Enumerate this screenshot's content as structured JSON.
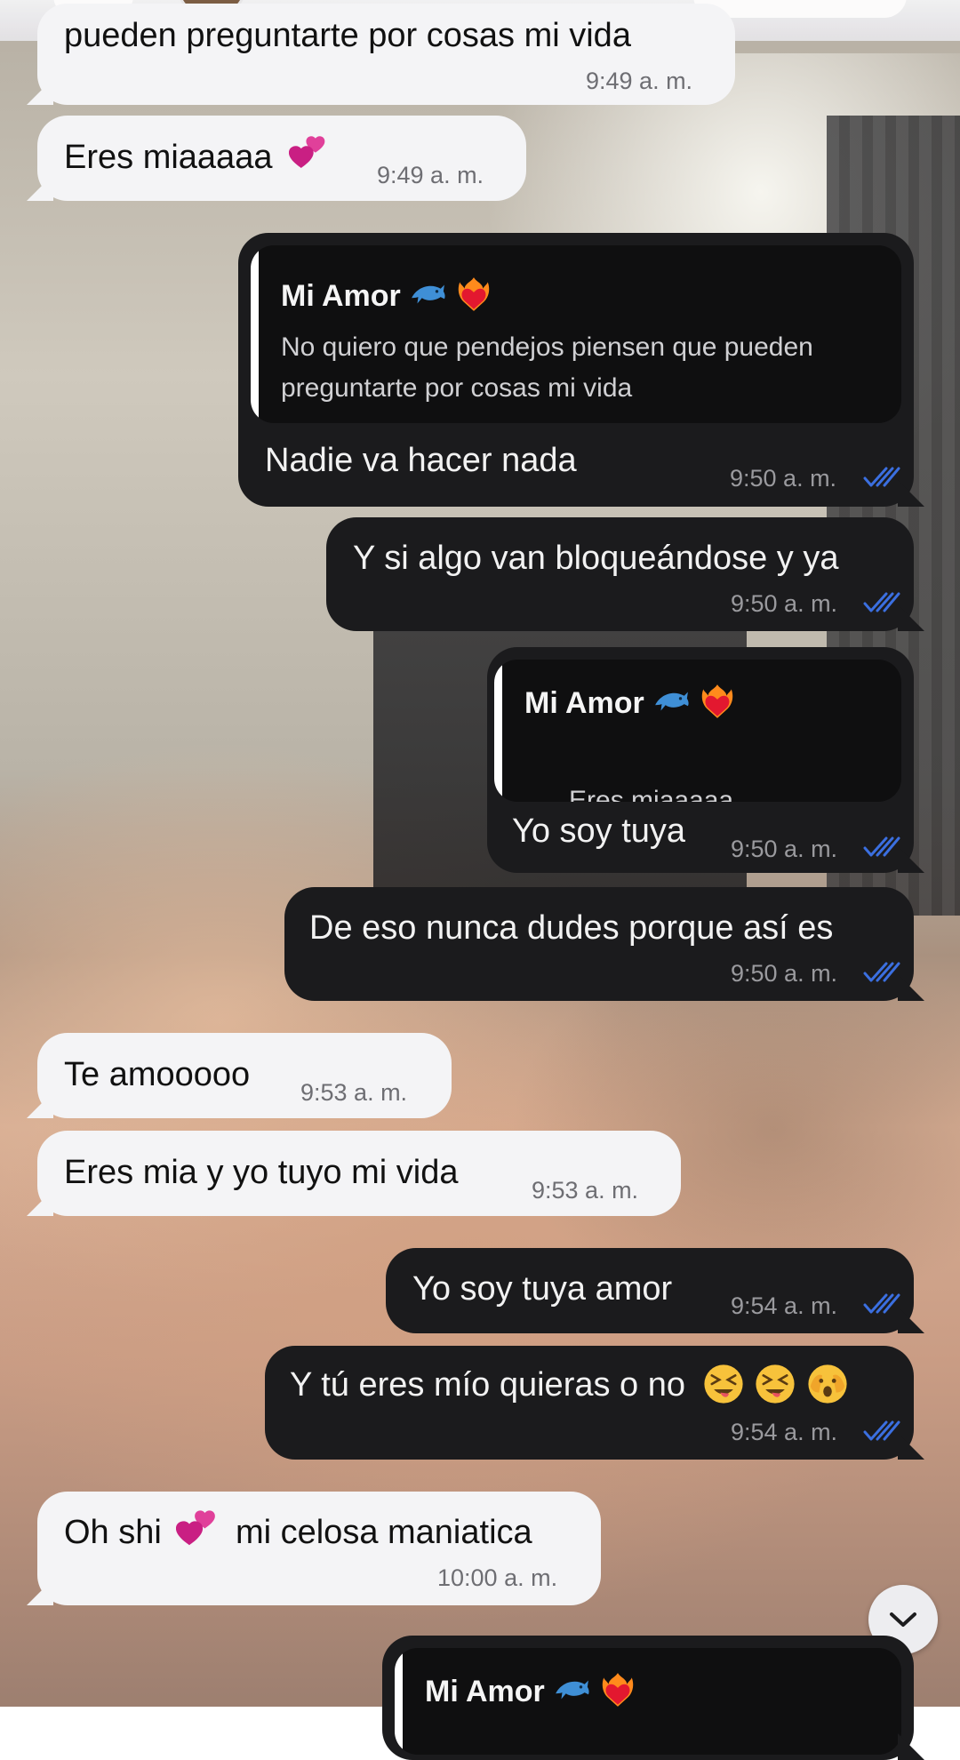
{
  "messages": [
    {
      "id": "m0",
      "text": "pueden preguntarte por cosas mi vida",
      "time": "9:49 a. m."
    },
    {
      "id": "m1",
      "text": "Eres miaaaaa",
      "emoji": "two-hearts",
      "time": "9:49 a. m."
    },
    {
      "id": "m2",
      "quote_name": "Mi Amor",
      "quote_text": "No quiero que pendejos piensen que pueden\npreguntarte por cosas mi vida",
      "text": "Nadie va hacer nada",
      "time": "9:50 a. m."
    },
    {
      "id": "m3",
      "text": "Y si algo van bloqueándose y ya",
      "time": "9:50 a. m."
    },
    {
      "id": "m4",
      "quote_name": "Mi Amor",
      "quote_text": "Eres miaaaaa",
      "text": "Yo soy tuya",
      "time": "9:50 a. m."
    },
    {
      "id": "m5",
      "text": "De eso nunca dudes porque así es",
      "time": "9:50 a. m."
    },
    {
      "id": "m6",
      "text": "Te amooooo",
      "time": "9:53 a. m."
    },
    {
      "id": "m7",
      "text": "Eres mia y yo tuyo mi vida",
      "time": "9:53 a. m."
    },
    {
      "id": "m8",
      "text": "Yo soy tuya amor",
      "time": "9:54 a. m."
    },
    {
      "id": "m9",
      "text": "Y tú eres mío quieras o no",
      "time": "9:54 a. m."
    },
    {
      "id": "m10",
      "text_a": "Oh shi",
      "text_b": "mi celosa maniatica",
      "time": "10:00 a. m."
    },
    {
      "id": "m11",
      "quote_name": "Mi Amor"
    }
  ],
  "icons": {
    "dolphin": "dolphin-icon",
    "heart_on_fire": "heart-on-fire-icon",
    "two_hearts": "two-hearts-icon",
    "read_ticks": "double-check-icon",
    "scroll_down": "chevron-down-icon"
  },
  "colors": {
    "incoming_bubble": "#f4f4f6",
    "outgoing_bubble": "#1b1b1d",
    "read_ticks": "#3b6fe0"
  }
}
